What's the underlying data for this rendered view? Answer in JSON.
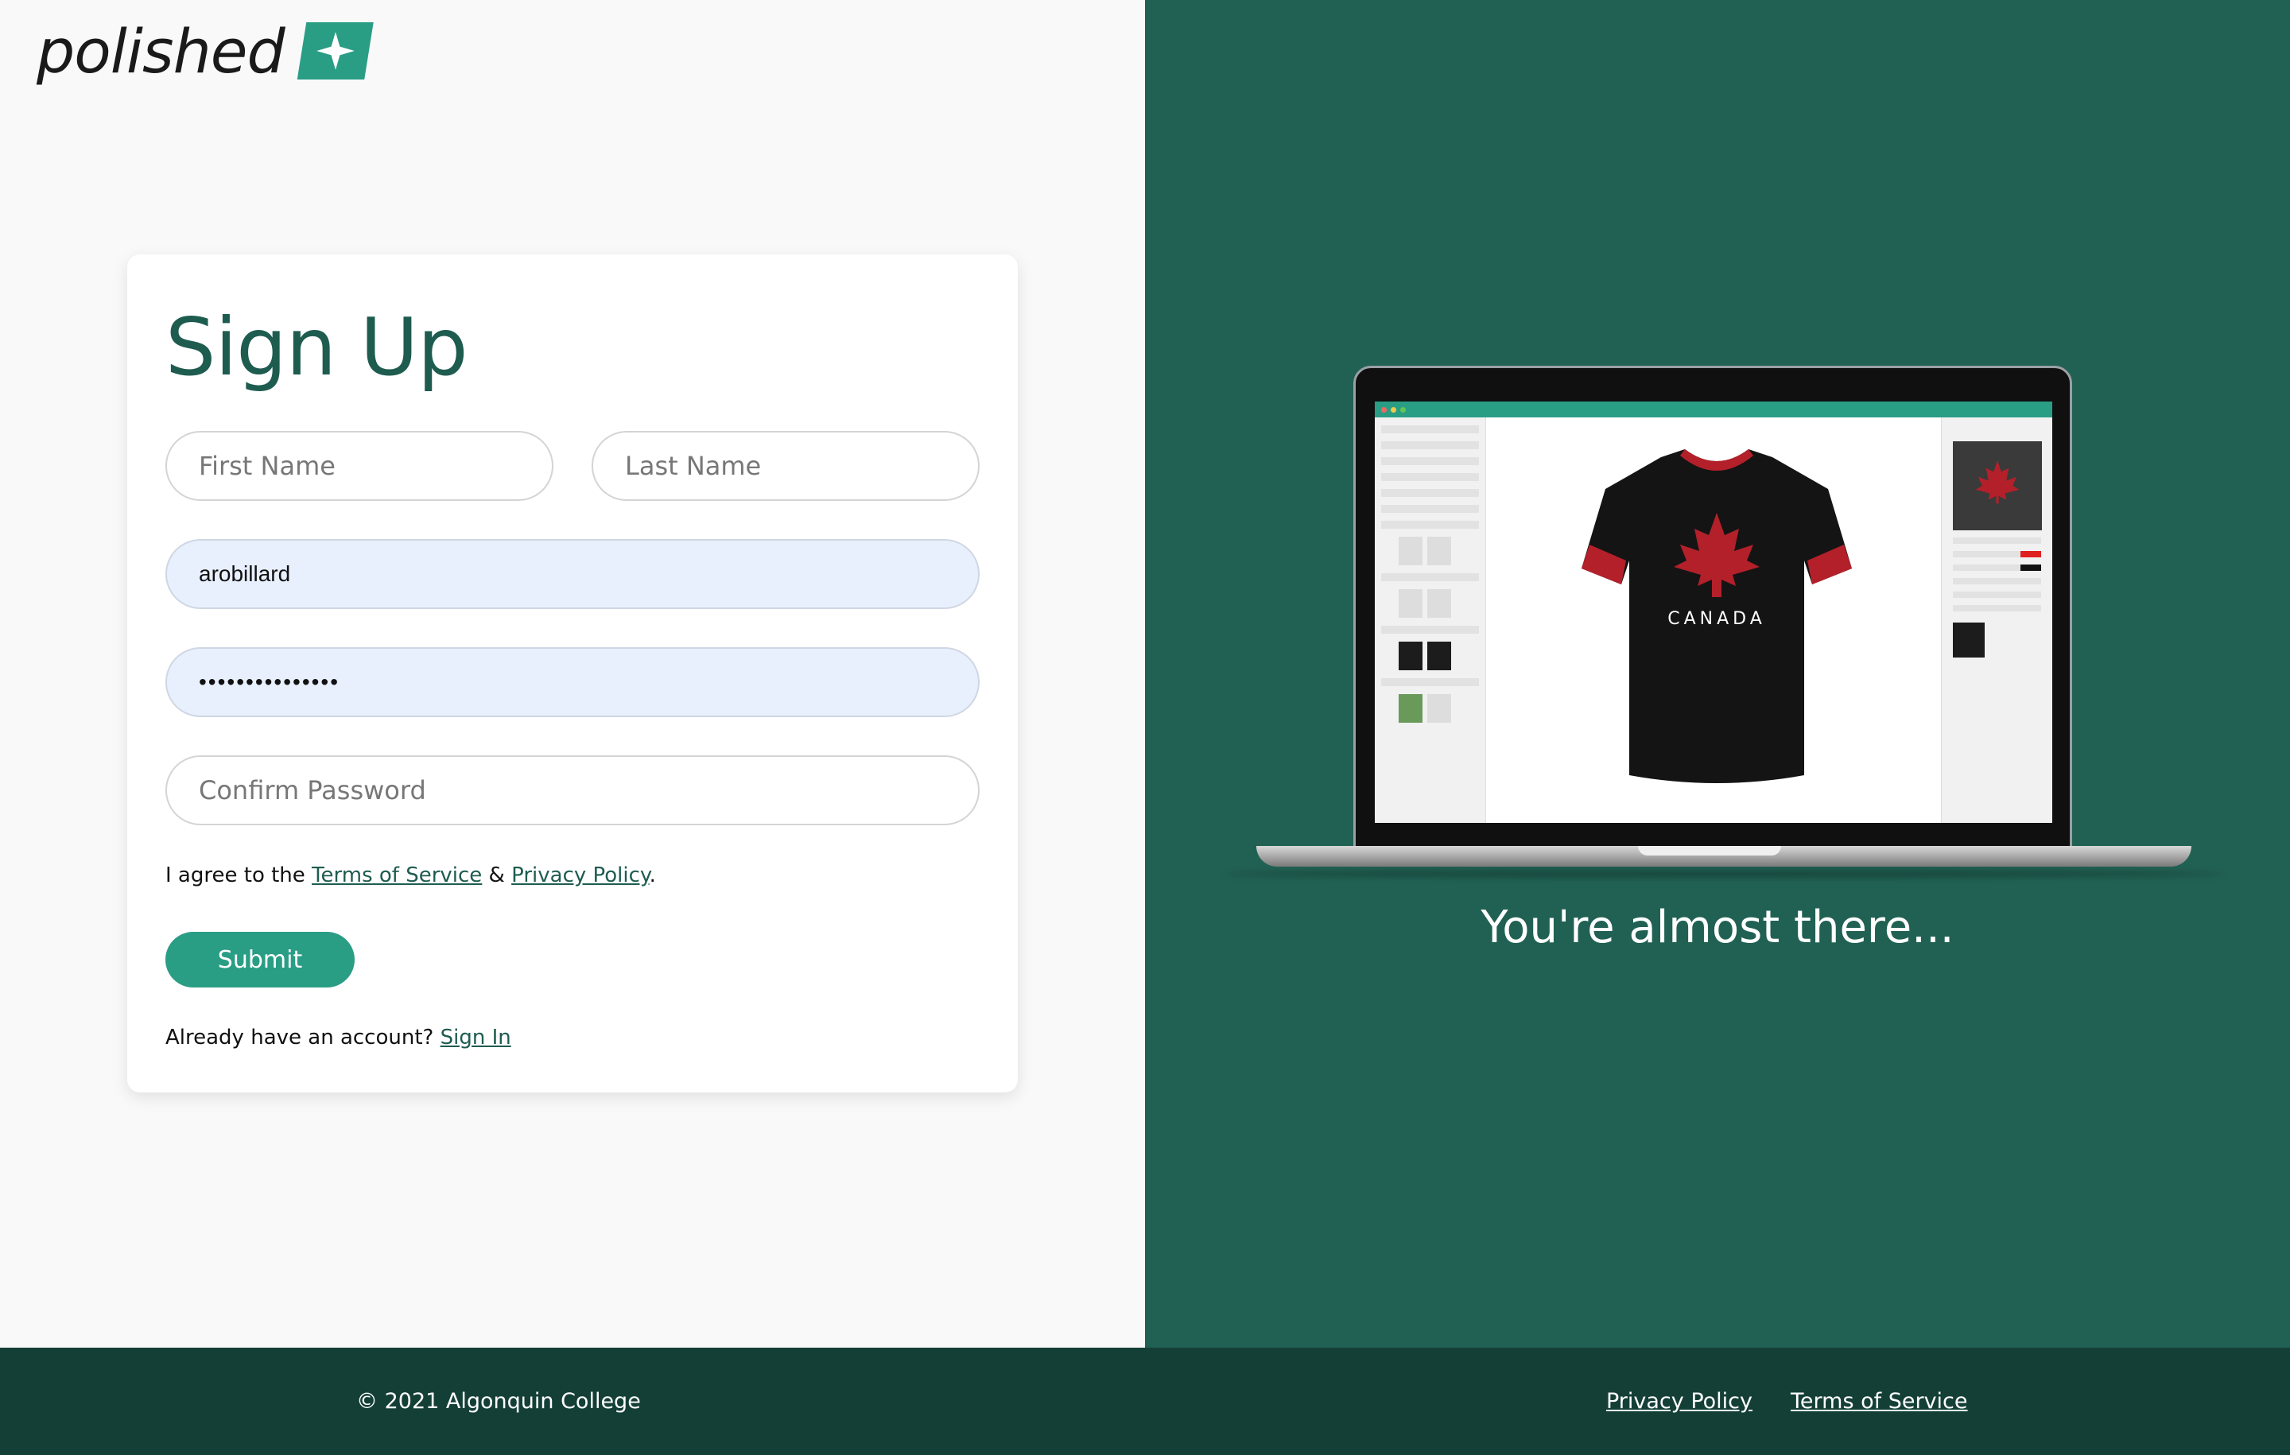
{
  "logo": {
    "text": "polished"
  },
  "signup": {
    "title": "Sign Up",
    "first_name_placeholder": "First Name",
    "last_name_placeholder": "Last Name",
    "username_value": "arobillard",
    "password_value": "•••••••••••••••",
    "confirm_password_placeholder": "Confirm Password",
    "agree_prefix": "I agree to the ",
    "terms_link": "Terms of Service",
    "agree_and": " & ",
    "privacy_link": "Privacy Policy",
    "agree_suffix": ".",
    "submit_label": "Submit",
    "signin_prompt": "Already have an account? ",
    "signin_link": "Sign In"
  },
  "hero": {
    "tagline": "You're almost there...",
    "jersey_text": "CANADA"
  },
  "footer": {
    "copyright": "© 2021 Algonquin College",
    "privacy_link": "Privacy Policy",
    "terms_link": "Terms of Service"
  },
  "colors": {
    "brand_green": "#2a9d85",
    "dark_green": "#216153",
    "footer_green": "#143f37",
    "title_green": "#1e5c50"
  }
}
